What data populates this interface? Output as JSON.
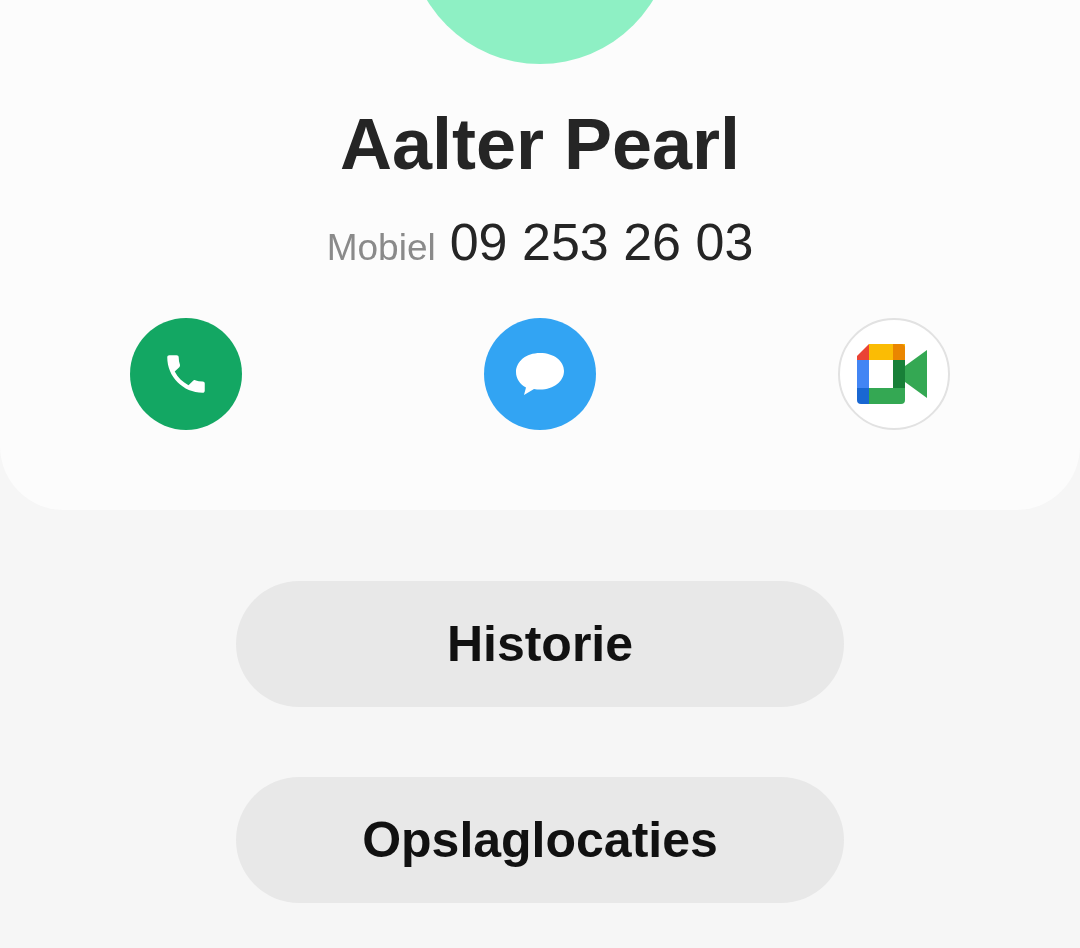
{
  "contact": {
    "name": "Aalter Pearl",
    "phone_label": "Mobiel",
    "phone_number": "09 253 26 03"
  },
  "actions": [
    {
      "kind": "call"
    },
    {
      "kind": "message"
    },
    {
      "kind": "video"
    }
  ],
  "buttons": [
    "Historie",
    "Opslaglocaties"
  ]
}
